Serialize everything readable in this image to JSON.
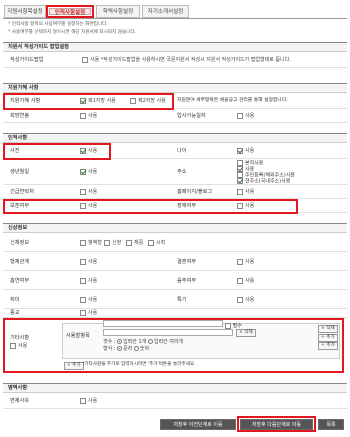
{
  "tabs": [
    "지원서항목설정",
    "인적사항설정",
    "학력사항설정",
    "자기소개서설정"
  ],
  "notes": [
    "* 인적사항 항목의 사용여부를 설정하는 화면입니다.",
    "* 사용여부를 선택하지 않으시면 해당 지원서에 표시되지 않습니다."
  ],
  "guide": {
    "title": "지원서 작성가이드 팝업설정",
    "label": "작성가이드팝업",
    "option": "사용 *작성가이드팝업을 사용하시면 국문지원서 작성시 지원서 작성가이드가 팝업형태로 뜹니다."
  },
  "hope": {
    "title": "지원가혜 사항",
    "label1": "지원가혜 사항",
    "opt1": "제1지망 사용",
    "opt2": "제2지망 사용",
    "note": "지원분야 세부항목은 채용공고 관리를 통해 설정합니다.",
    "label2": "희망연봉",
    "opt3": "사용",
    "label3": "입사가능일자",
    "opt4": "사용"
  },
  "personal": {
    "title": "인적사항",
    "photo": "사진",
    "photo_opt": "사용",
    "age": "나이",
    "age_opt": "사용",
    "birth": "생년월일",
    "birth_opt": "사용",
    "addr": "주소",
    "addr_opts": [
      "본적사용",
      "사용",
      "주민등록(해외주소)사용",
      "현주소(국내주소)사용"
    ],
    "contact": "긴급연락처",
    "contact_opt": "사용",
    "home": "홈페이지/블로그",
    "home_opt": "사용",
    "veteran": "보훈여부",
    "veteran_opt": "사용",
    "disabled": "장애여부",
    "disabled_opt": "사용"
  },
  "other": {
    "title": "신상정보",
    "body": "신체정보",
    "body_opts": [
      "혈액형",
      "신장",
      "체중",
      "시력"
    ],
    "family": "형제관계",
    "family_opt": "사용",
    "marriage": "결혼여부",
    "marriage_opt": "사용",
    "smoke": "흡연여부",
    "smoke_opt": "사용",
    "drink": "음주여부",
    "drink_opt": "사용",
    "hobby": "취미",
    "hobby_opt": "사용",
    "skill": "특기",
    "skill_opt": "사용",
    "religion": "종교",
    "religion_opt": "사용"
  },
  "extra": {
    "label": "기타사항",
    "label_opt": "사용",
    "sublabel": "사용할항목",
    "required": "필수",
    "delete": "× 삭제",
    "add": "+ 추가",
    "count_label": "갯수 :",
    "radio1": "입력칸 1개",
    "radio2": "입력칸 여러개",
    "type_label": "형식 :",
    "radio3": "문자",
    "radio4": "숫자",
    "hint": "*기타사항을 추가로 입력하시려면 '추가'버튼을 눌러주세요."
  },
  "military": {
    "title": "병역사항",
    "label": "면제사유",
    "opt": "사용"
  },
  "buttons": {
    "prev": "저장후 이전단계로 이동",
    "next": "저장후 다음단계로 이동",
    "close": "목록"
  }
}
